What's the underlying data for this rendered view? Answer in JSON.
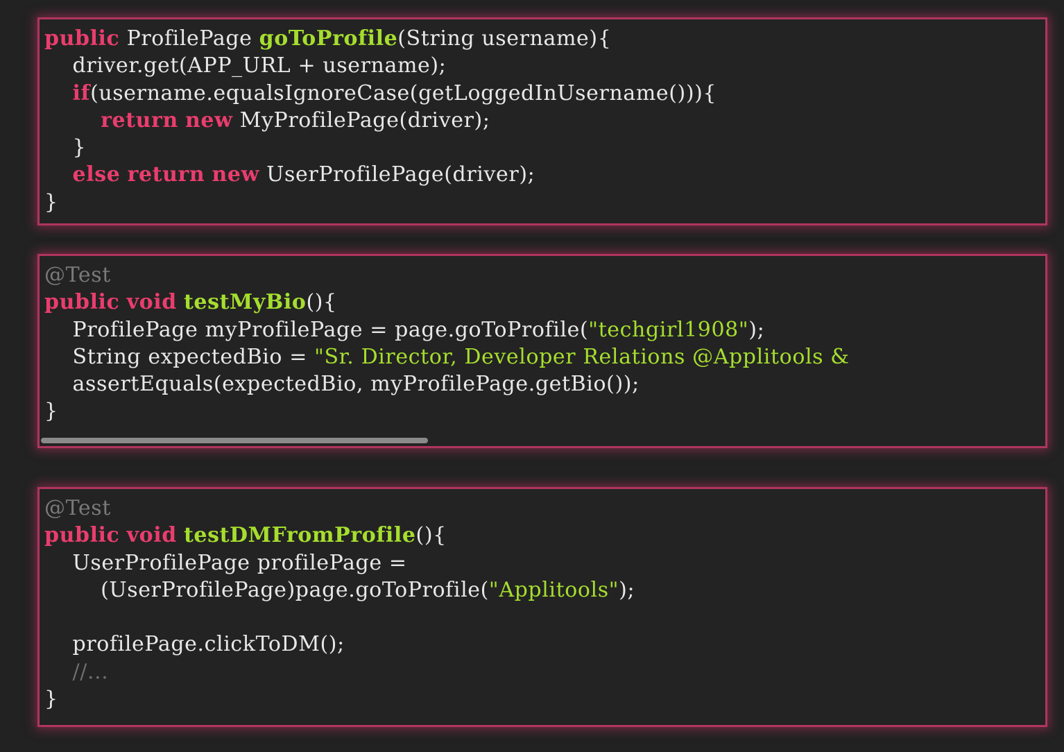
{
  "colors": {
    "background": "#222222",
    "panel_background": "#232323",
    "panel_border": "#b0355e",
    "keyword": "#ea3d6e",
    "method_name": "#a6de2e",
    "string": "#a6de2e",
    "annotation": "#7a7a7a",
    "plain_text": "#e8e8e8"
  },
  "panels": [
    {
      "lines": [
        [
          {
            "t": "kw",
            "v": "public"
          },
          {
            "t": "plain",
            "v": " ProfilePage "
          },
          {
            "t": "fn",
            "v": "goToProfile"
          },
          {
            "t": "plain",
            "v": "(String username){"
          }
        ],
        [
          {
            "t": "plain",
            "v": "    driver.get(APP_URL + username);"
          }
        ],
        [
          {
            "t": "plain",
            "v": "    "
          },
          {
            "t": "kw",
            "v": "if"
          },
          {
            "t": "plain",
            "v": "(username.equalsIgnoreCase(getLoggedInUsername())){"
          }
        ],
        [
          {
            "t": "plain",
            "v": "        "
          },
          {
            "t": "kw",
            "v": "return"
          },
          {
            "t": "plain",
            "v": " "
          },
          {
            "t": "kw",
            "v": "new"
          },
          {
            "t": "plain",
            "v": " MyProfilePage(driver);"
          }
        ],
        [
          {
            "t": "plain",
            "v": "    }"
          }
        ],
        [
          {
            "t": "plain",
            "v": "    "
          },
          {
            "t": "kw",
            "v": "else"
          },
          {
            "t": "plain",
            "v": " "
          },
          {
            "t": "kw",
            "v": "return"
          },
          {
            "t": "plain",
            "v": " "
          },
          {
            "t": "kw",
            "v": "new"
          },
          {
            "t": "plain",
            "v": " UserProfilePage(driver);"
          }
        ],
        [
          {
            "t": "plain",
            "v": "}"
          }
        ]
      ]
    },
    {
      "lines": [
        [
          {
            "t": "ann",
            "v": "@Test"
          }
        ],
        [
          {
            "t": "kw",
            "v": "public"
          },
          {
            "t": "plain",
            "v": " "
          },
          {
            "t": "kw",
            "v": "void"
          },
          {
            "t": "plain",
            "v": " "
          },
          {
            "t": "fn",
            "v": "testMyBio"
          },
          {
            "t": "plain",
            "v": "(){"
          }
        ],
        [
          {
            "t": "plain",
            "v": "    ProfilePage myProfilePage = page.goToProfile("
          },
          {
            "t": "str",
            "v": "\"techgirl1908\""
          },
          {
            "t": "plain",
            "v": ");"
          }
        ],
        [
          {
            "t": "plain",
            "v": "    String expectedBio = "
          },
          {
            "t": "str",
            "v": "\"Sr. Director, Developer Relations @Applitools &"
          }
        ],
        [
          {
            "t": "plain",
            "v": "    assertEquals(expectedBio, myProfilePage.getBio());"
          }
        ],
        [
          {
            "t": "plain",
            "v": "}"
          }
        ]
      ],
      "scrollbar": {
        "visible_fraction": 0.385
      }
    },
    {
      "lines": [
        [
          {
            "t": "ann",
            "v": "@Test"
          }
        ],
        [
          {
            "t": "kw",
            "v": "public"
          },
          {
            "t": "plain",
            "v": " "
          },
          {
            "t": "kw",
            "v": "void"
          },
          {
            "t": "plain",
            "v": " "
          },
          {
            "t": "fn",
            "v": "testDMFromProfile"
          },
          {
            "t": "plain",
            "v": "(){"
          }
        ],
        [
          {
            "t": "plain",
            "v": "    UserProfilePage profilePage ="
          }
        ],
        [
          {
            "t": "plain",
            "v": "        (UserProfilePage)page.goToProfile("
          },
          {
            "t": "str",
            "v": "\"Applitools\""
          },
          {
            "t": "plain",
            "v": ");"
          }
        ],
        [
          {
            "t": "plain",
            "v": ""
          }
        ],
        [
          {
            "t": "plain",
            "v": "    profilePage.clickToDM();"
          }
        ],
        [
          {
            "t": "plain",
            "v": "    "
          },
          {
            "t": "cmt",
            "v": "//..."
          }
        ],
        [
          {
            "t": "plain",
            "v": "}"
          }
        ]
      ]
    }
  ]
}
